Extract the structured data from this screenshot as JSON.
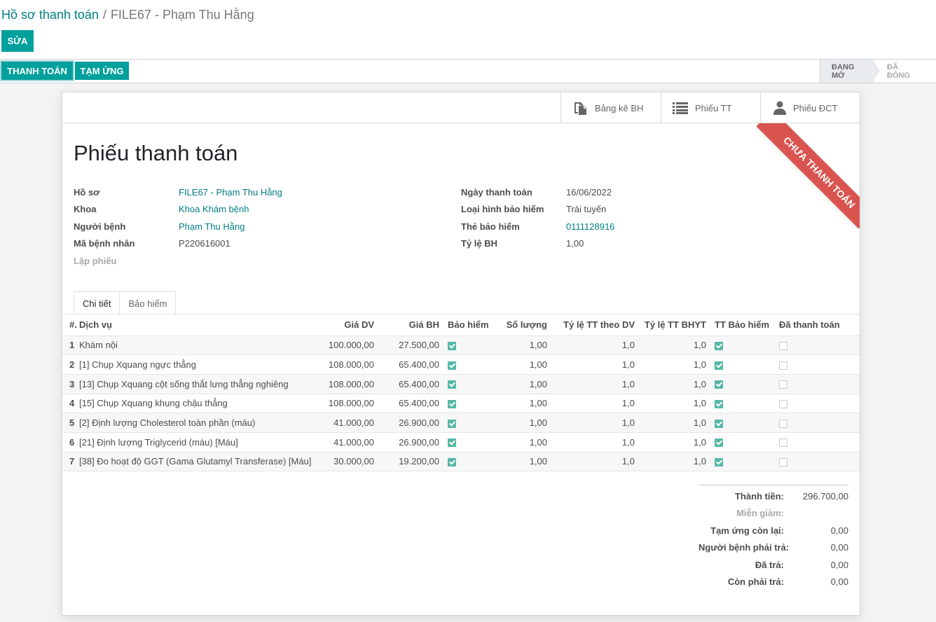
{
  "breadcrumb": {
    "parent": "Hồ sơ thanh toán",
    "separator": "/",
    "current": "FILE67 - Phạm Thu Hằng"
  },
  "actions": {
    "edit": "Sửa",
    "pay": "Thanh toán",
    "advance": "Tạm ứng"
  },
  "stages": {
    "open": "Đang mở",
    "closed": "Đã đóng"
  },
  "smart_buttons": {
    "insurance_list": "Bảng kê BH",
    "payment_slip": "Phiếu TT",
    "diff_slip": "Phiếu ĐCT"
  },
  "ribbon": "Chưa thanh toán",
  "title": "Phiếu thanh toán",
  "left_fields": [
    {
      "label": "Hồ sơ",
      "value": "FILE67 - Phạm Thu Hằng"
    },
    {
      "label": "Khoa",
      "value": "Khoa Khám bệnh"
    },
    {
      "label": "Người bệnh",
      "value": "Phạm Thu Hằng"
    },
    {
      "label": "Mã bệnh nhân",
      "value": "P220616001"
    },
    {
      "label": "Lập phiếu",
      "value": ""
    }
  ],
  "right_fields": [
    {
      "label": "Ngày thanh toán",
      "value": "16/06/2022"
    },
    {
      "label": "Loại hình bảo hiểm",
      "value": "Trái tuyến"
    },
    {
      "label": "Thẻ bảo hiểm",
      "value": "0111128916"
    },
    {
      "label": "Tỷ lệ BH",
      "value": "1,00"
    }
  ],
  "tabs": {
    "detail": "Chi tiết",
    "insurance": "Bảo hiểm"
  },
  "columns": [
    "#.",
    "Dịch vụ",
    "Giá DV",
    "Giá BH",
    "Bảo hiểm",
    "Số lượng",
    "Tỷ lệ TT theo DV",
    "Tỷ lệ TT BHYT",
    "TT Bảo hiểm",
    "Đã thanh toán"
  ],
  "rows": [
    {
      "no": "1",
      "service": "Khám nội",
      "price": "100.000,00",
      "price_bh": "27.500,00",
      "qty": "1,00",
      "rate_dv": "1,0",
      "rate_bhyt": "1,0"
    },
    {
      "no": "2",
      "service": "[1] Chụp Xquang ngực thẳng",
      "price": "108.000,00",
      "price_bh": "65.400,00",
      "qty": "1,00",
      "rate_dv": "1,0",
      "rate_bhyt": "1,0"
    },
    {
      "no": "3",
      "service": "[13] Chụp Xquang cột sống thắt lưng thẳng nghiêng",
      "price": "108.000,00",
      "price_bh": "65.400,00",
      "qty": "1,00",
      "rate_dv": "1,0",
      "rate_bhyt": "1,0"
    },
    {
      "no": "4",
      "service": "[15] Chụp Xquang khung chậu thẳng",
      "price": "108.000,00",
      "price_bh": "65.400,00",
      "qty": "1,00",
      "rate_dv": "1,0",
      "rate_bhyt": "1,0"
    },
    {
      "no": "5",
      "service": "[2] Định lượng Cholesterol toàn phần (máu)",
      "price": "41.000,00",
      "price_bh": "26.900,00",
      "qty": "1,00",
      "rate_dv": "1,0",
      "rate_bhyt": "1,0"
    },
    {
      "no": "6",
      "service": "[21] Định lượng Triglycerid (máu) [Máu]",
      "price": "41.000,00",
      "price_bh": "26.900,00",
      "qty": "1,00",
      "rate_dv": "1,0",
      "rate_bhyt": "1,0"
    },
    {
      "no": "7",
      "service": "[38] Đo hoạt độ GGT (Gama Glutamyl Transferase) [Máu]",
      "price": "30.000,00",
      "price_bh": "19.200,00",
      "qty": "1,00",
      "rate_dv": "1,0",
      "rate_bhyt": "1,0"
    }
  ],
  "totals": [
    {
      "label": "Thành tiền:",
      "value": "296.700,00"
    },
    {
      "label": "Miễn giảm:",
      "value": ""
    },
    {
      "label": "Tạm ứng còn lại:",
      "value": "0,00"
    },
    {
      "label": "Người bệnh phải trả:",
      "value": "0,00"
    },
    {
      "label": "Đã trả:",
      "value": "0,00"
    },
    {
      "label": "Còn phải trả:",
      "value": "0,00"
    }
  ],
  "colors": {
    "primary": "#00a09d",
    "link": "#017e84",
    "ribbon": "#d9534f",
    "checkbox_on": "#56b8a4"
  }
}
